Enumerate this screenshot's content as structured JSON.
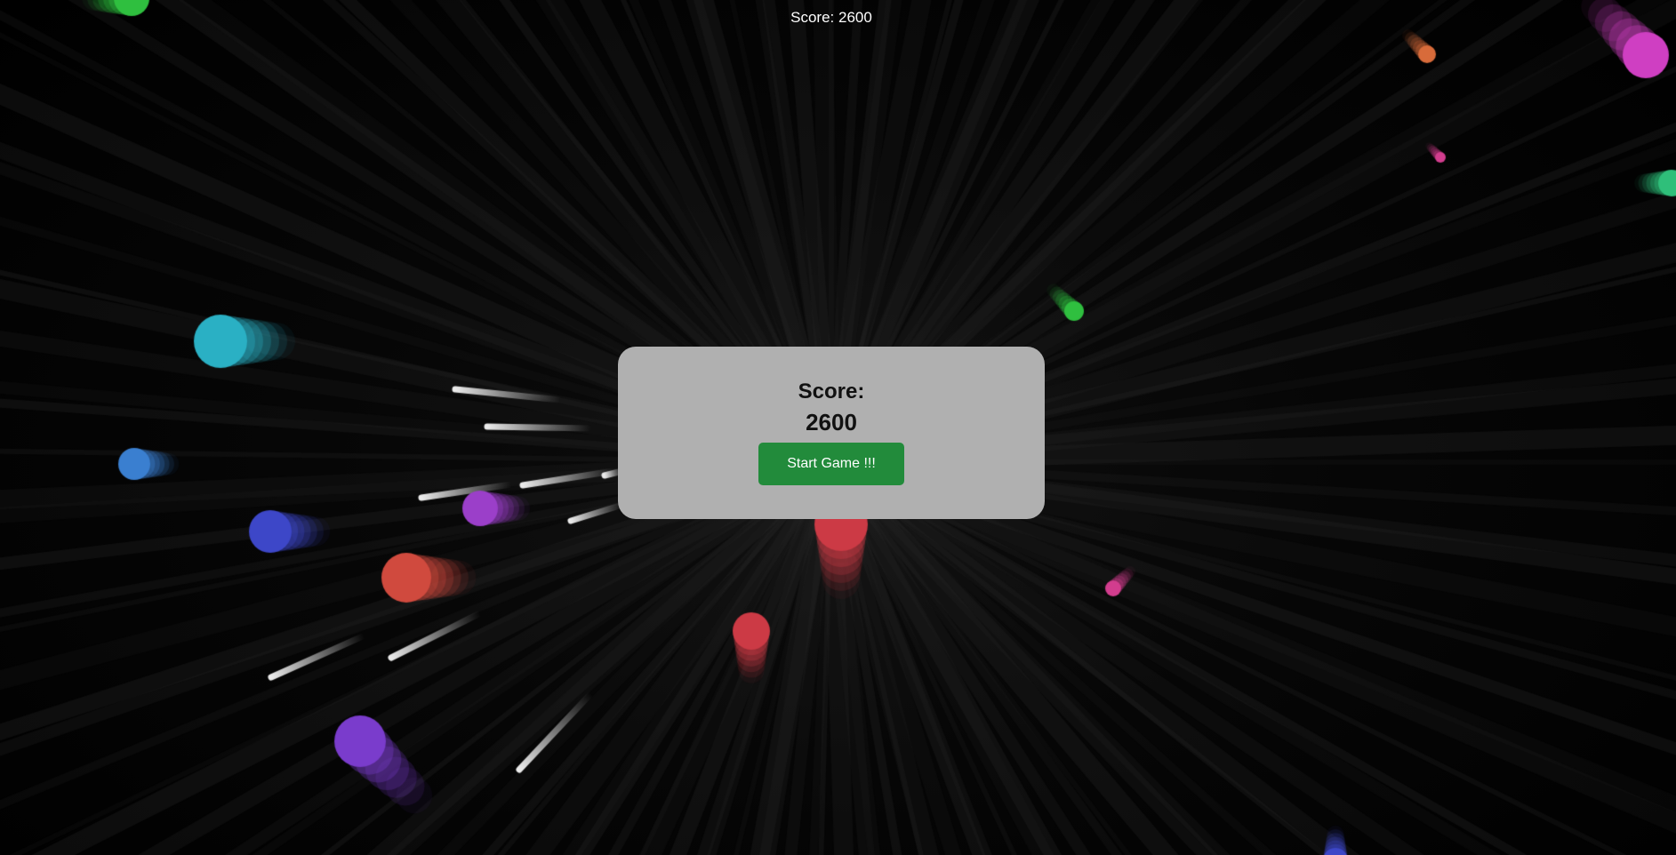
{
  "hud": {
    "score_label": "Score:",
    "score_value": "2600"
  },
  "modal": {
    "score_label": "Score:",
    "score_value": "2600",
    "start_button_label": "Start Game !!!"
  },
  "colors": {
    "background": "#000000",
    "modal_bg": "#b0b0b0",
    "start_button": "#228b3b",
    "enemy_palette": [
      "#2ab0c4",
      "#3a7fd0",
      "#3d47c8",
      "#9b3fc9",
      "#d04a3e",
      "#cc3a45",
      "#7a3ccc",
      "#2fbf3f",
      "#d86b3a",
      "#cf3fc2",
      "#d23d8e",
      "#2fbf7a"
    ]
  }
}
